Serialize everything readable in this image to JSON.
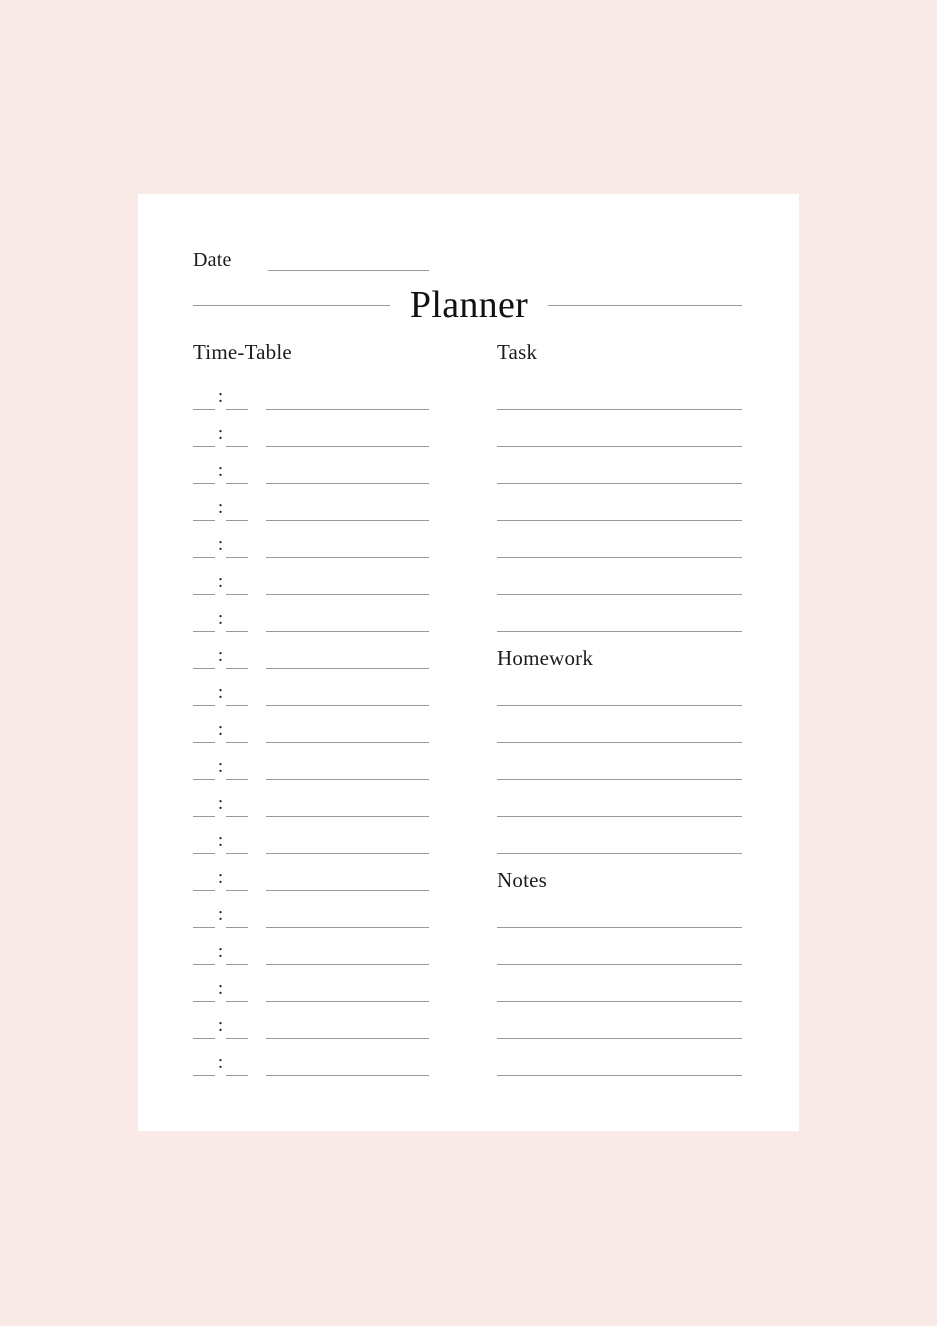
{
  "theme": {
    "background_color": "#f9eae7",
    "card_color": "#ffffff",
    "rule_color": "#9a9a9a",
    "text_color": "#1c1c1c"
  },
  "header": {
    "date_label": "Date",
    "title": "Planner"
  },
  "columns": {
    "timetable": {
      "header": "Time-Table",
      "row_count": 19,
      "time_separator": ":"
    },
    "right": {
      "task": {
        "header": "Task",
        "line_count": 7
      },
      "homework": {
        "header": "Homework",
        "line_count": 5
      },
      "notes": {
        "header": "Notes",
        "line_count": 5
      }
    }
  }
}
